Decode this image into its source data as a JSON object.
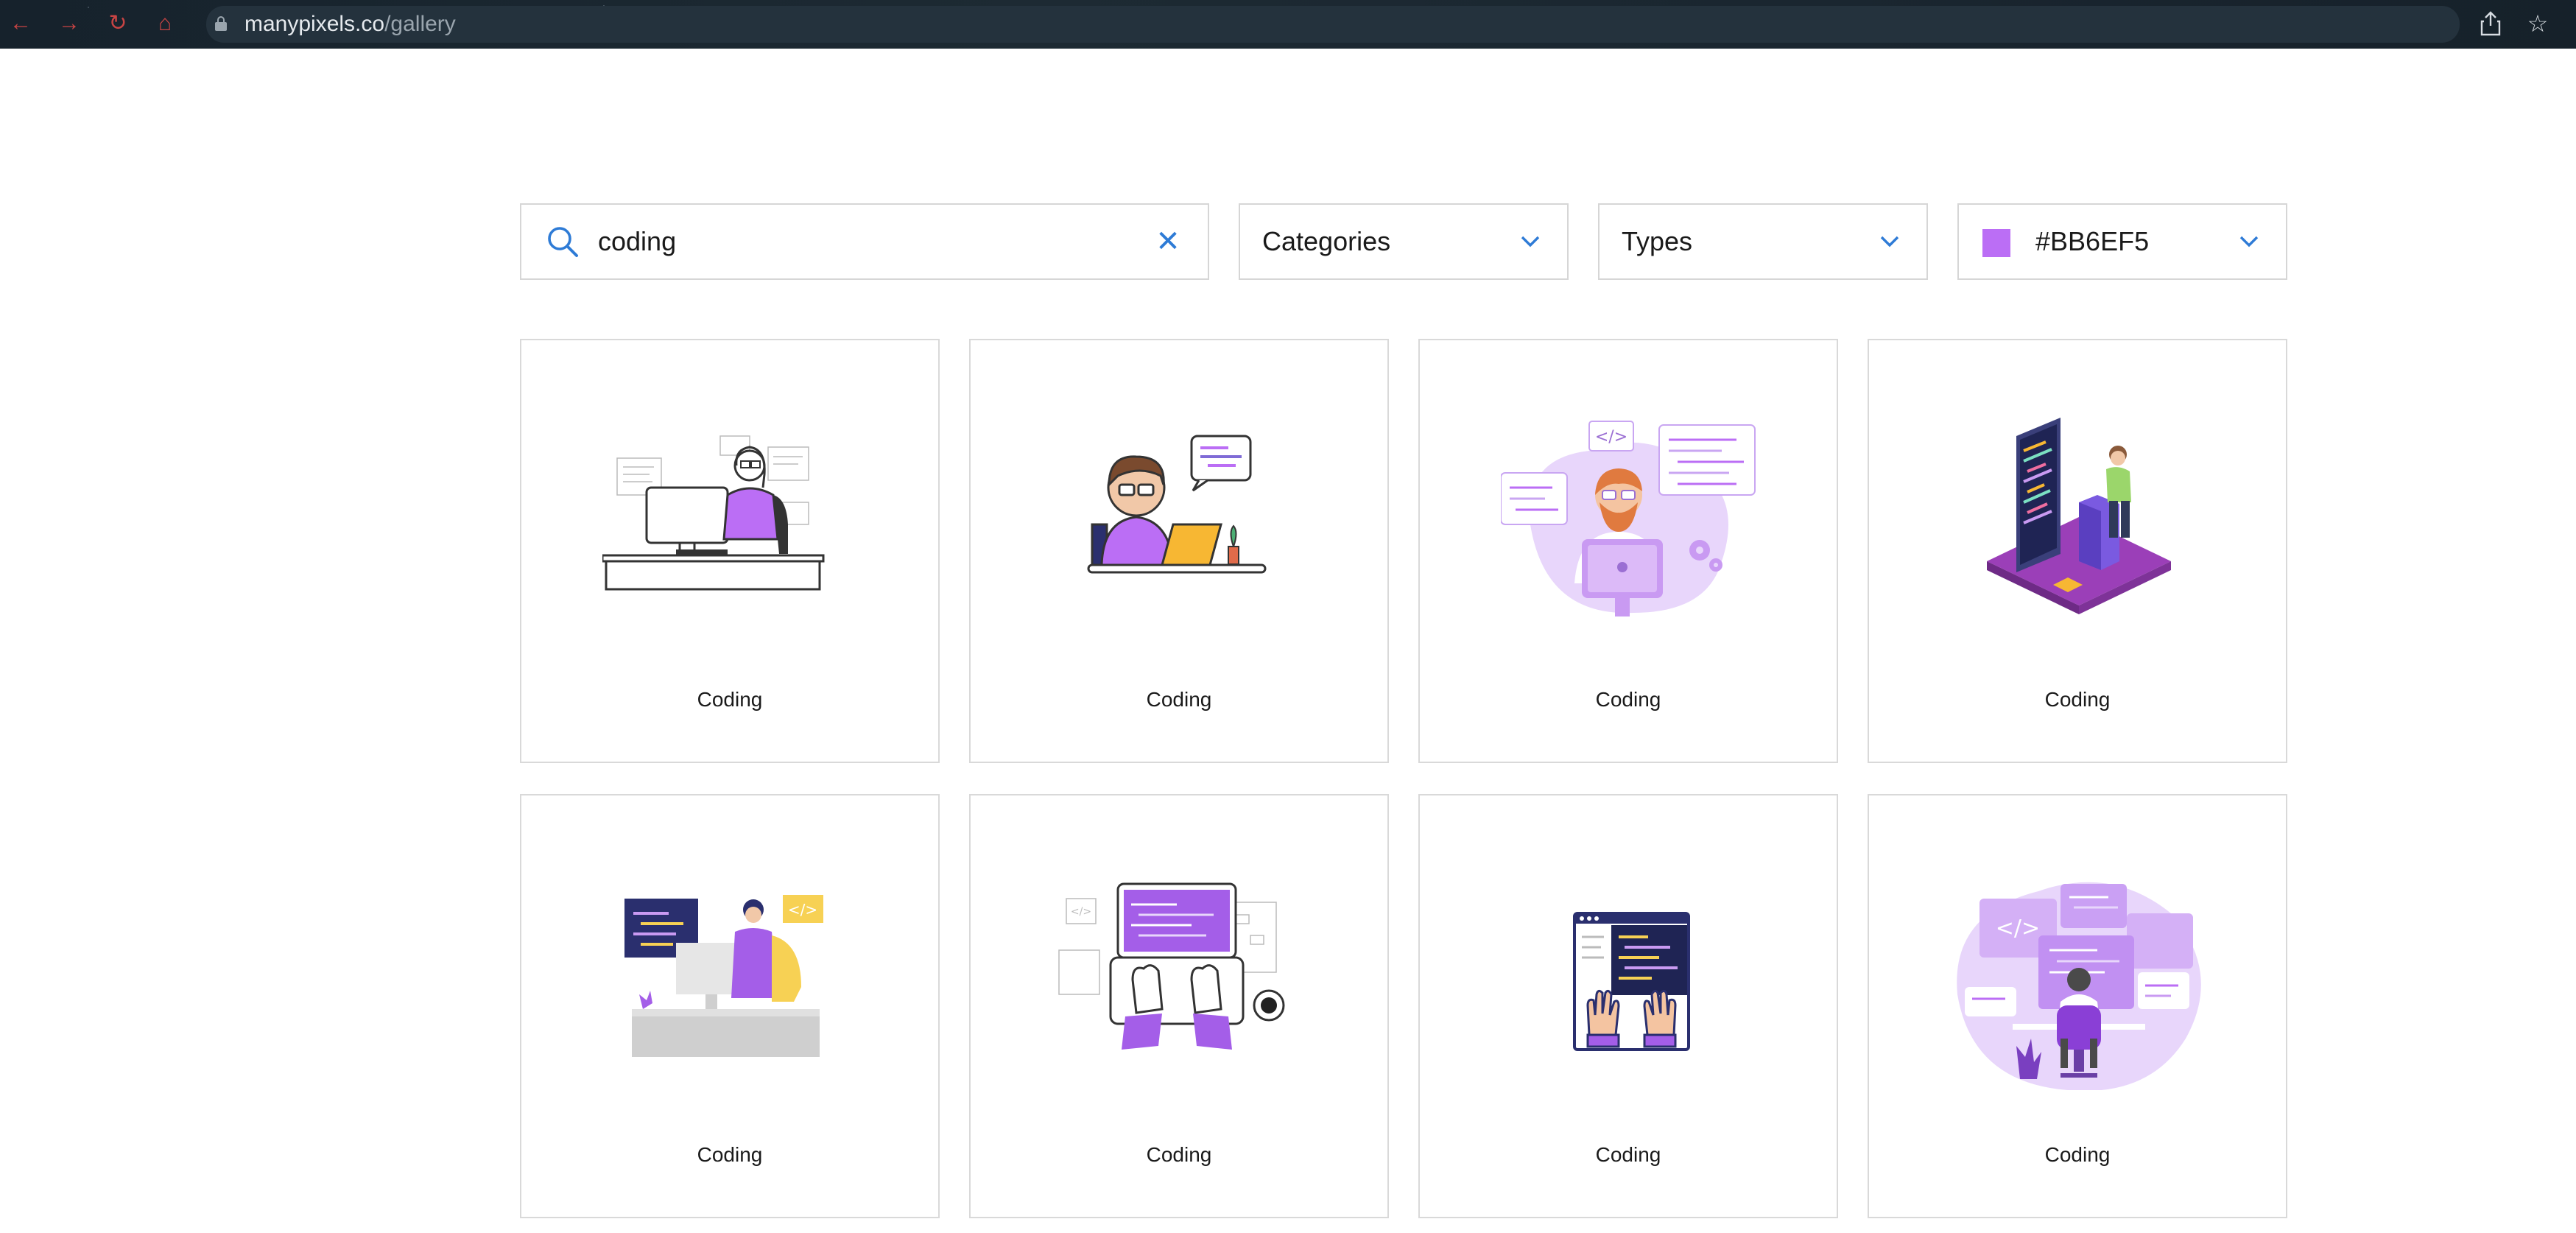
{
  "browser": {
    "url_domain": "manypixels.co",
    "url_path": "/gallery",
    "nav_icons": [
      "back-icon",
      "forward-icon",
      "reload-icon",
      "home-icon"
    ],
    "toolbar_icons": [
      "share-icon",
      "bookmark-star-icon"
    ]
  },
  "filters": {
    "search": {
      "value": "coding"
    },
    "categories_label": "Categories",
    "types_label": "Types",
    "color": {
      "value": "#BB6EF5",
      "label": "#BB6EF5"
    }
  },
  "accent_color": "#2e7bd6",
  "gallery": {
    "items": [
      {
        "title": "Coding"
      },
      {
        "title": "Coding"
      },
      {
        "title": "Coding"
      },
      {
        "title": "Coding"
      },
      {
        "title": "Coding"
      },
      {
        "title": "Coding"
      },
      {
        "title": "Coding"
      },
      {
        "title": "Coding"
      }
    ]
  }
}
